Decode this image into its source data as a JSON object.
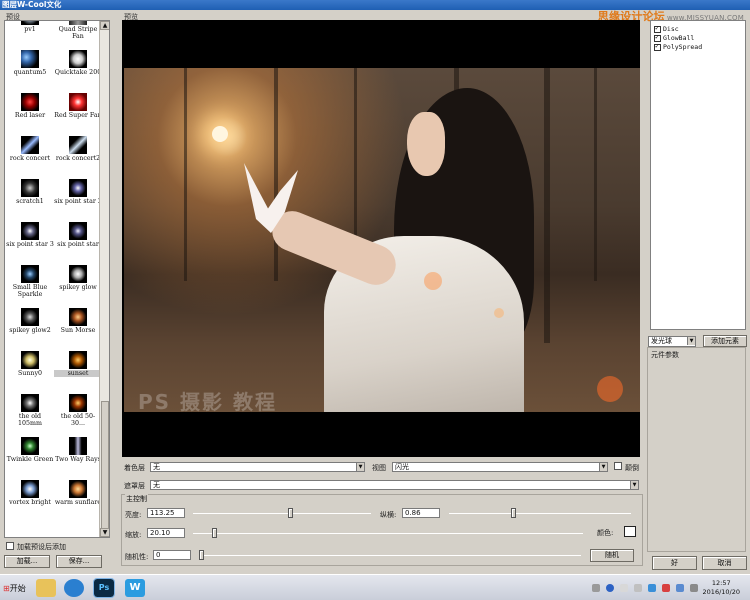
{
  "window": {
    "title": "图层W-Cool文化"
  },
  "watermark": {
    "text": "思缘设计论坛",
    "sub": "www.MISSYUAN.COM"
  },
  "presets_panel": {
    "label": "预设",
    "items": [
      {
        "name": "pv1"
      },
      {
        "name": "Quad Stripe Fan"
      },
      {
        "name": "quantum5"
      },
      {
        "name": "Quicktake 200"
      },
      {
        "name": "Red laser"
      },
      {
        "name": "Red Super Fan"
      },
      {
        "name": "rock concert"
      },
      {
        "name": "rock concert2"
      },
      {
        "name": "scratch1"
      },
      {
        "name": "six point star 2"
      },
      {
        "name": "six point star 3"
      },
      {
        "name": "six point star"
      },
      {
        "name": "Small Blue Sparkle"
      },
      {
        "name": "spikey glow"
      },
      {
        "name": "spikey glow2"
      },
      {
        "name": "Sun Morse"
      },
      {
        "name": "Sunny0"
      },
      {
        "name": "sunset"
      },
      {
        "name": "the old 105mm"
      },
      {
        "name": "the old 50-30..."
      },
      {
        "name": "Twinkle Green"
      },
      {
        "name": "Two Way Rays"
      },
      {
        "name": "vortex bright"
      },
      {
        "name": "warm sunflare"
      }
    ],
    "selected": "sunset",
    "checkbox_label": "加载预设后添加",
    "load_button": "加载...",
    "save_button": "保存..."
  },
  "preview": {
    "label": "预览",
    "caption_watermark": "PS  摄影 教程"
  },
  "layers": {
    "color_layer_label": "着色层",
    "color_layer_value": "无",
    "view_label": "视图",
    "view_value": "闪光",
    "invert_label": "颠倒",
    "mask_layer_label": "遮罩层",
    "mask_layer_value": "无"
  },
  "main_control": {
    "title": "主控制",
    "brightness_label": "亮度:",
    "brightness_value": "113.25",
    "brightness_level": 0.55,
    "scale_label": "纵横:",
    "scale_value": "0.86",
    "scale_level": 0.35,
    "zoom_label": "缩放:",
    "zoom_value": "20.10",
    "zoom_level": 0.05,
    "color_label": "颜色:",
    "random_label": "随机性:",
    "random_value": "0",
    "random_level": 0.0,
    "random_button": "随机"
  },
  "elements_panel": {
    "items": [
      {
        "name": "Disc",
        "checked": true
      },
      {
        "name": "GlowBall",
        "checked": true
      },
      {
        "name": "PolySpread",
        "checked": true
      }
    ],
    "element_type": "发光球",
    "add_button": "添加元素",
    "params_label": "元件参数"
  },
  "dialog_buttons": {
    "ok": "好",
    "cancel": "取消"
  },
  "taskbar": {
    "start_label": "开始",
    "time": "12:57",
    "date": "2016/10/20"
  }
}
